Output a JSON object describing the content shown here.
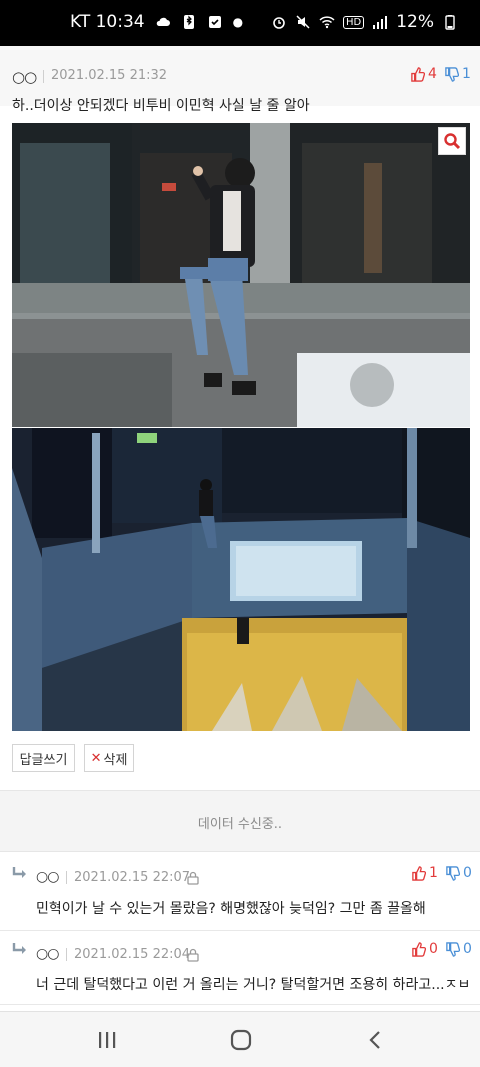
{
  "status_bar": {
    "carrier_time": "KT 10:34",
    "battery": "12%",
    "hd_badge": "HD"
  },
  "post": {
    "author": "○○",
    "date": "2021.02.15 21:32",
    "upvotes": "4",
    "downvotes": "1",
    "title": "하..더이상 안되겠다 비투비 이민혁 사실 날 줄 알아"
  },
  "actions": {
    "reply_label": "답글쓰기",
    "delete_label": "삭제"
  },
  "loading_text": "데이터 수신중..",
  "comments": [
    {
      "author": "○○",
      "date": "2021.02.15 22:07",
      "upvotes": "1",
      "downvotes": "0",
      "text": "민혁이가 날 수 있는거 몰랐음? 해명했잖아 늦덕임? 그만 좀 끌올해"
    },
    {
      "author": "○○",
      "date": "2021.02.15 22:04",
      "upvotes": "0",
      "downvotes": "0",
      "text": "너 근데 탈덕했다고 이런 거 올리는 거니? 탈덕할거면 조용히 하라고...ㅈㅂ"
    }
  ],
  "colors": {
    "upvote": "#e23b3b",
    "downvote": "#4a8fd6"
  },
  "icons": [
    "cloud-icon",
    "bluetooth-icon",
    "check-icon",
    "alarm-icon",
    "mute-icon",
    "wifi-icon",
    "signal-icon",
    "battery-icon",
    "thumbs-up-icon",
    "thumbs-down-icon",
    "search-icon",
    "close-icon",
    "reply-arrow-icon",
    "lock-icon",
    "recent-apps-icon",
    "home-icon",
    "back-icon"
  ]
}
